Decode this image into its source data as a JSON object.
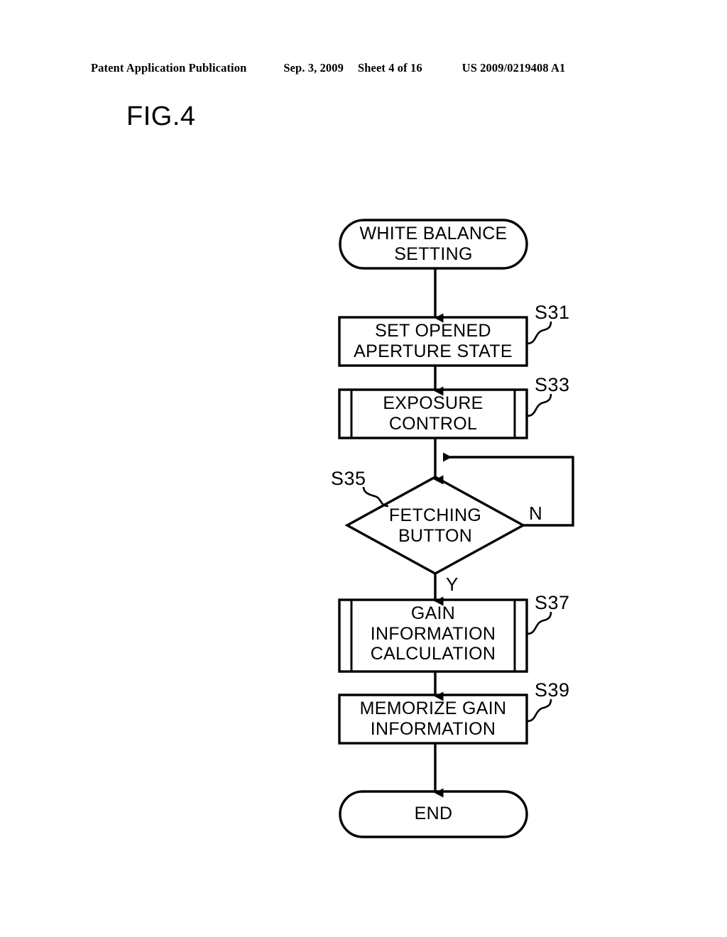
{
  "header": {
    "publication": "Patent Application Publication",
    "date": "Sep. 3, 2009",
    "sheet": "Sheet 4 of 16",
    "patent_number": "US 2009/0219408 A1"
  },
  "figure": {
    "label": "FIG.4"
  },
  "flowchart": {
    "nodes": [
      {
        "id": "start",
        "shape": "terminal",
        "text": "WHITE BALANCE\nSETTING"
      },
      {
        "id": "s31",
        "shape": "process",
        "text": "SET OPENED\nAPERTURE STATE",
        "step": "S31"
      },
      {
        "id": "s33",
        "shape": "predefined-process",
        "text": "EXPOSURE\nCONTROL",
        "step": "S33"
      },
      {
        "id": "s35",
        "shape": "decision",
        "text": "FETCHING\nBUTTON",
        "step": "S35"
      },
      {
        "id": "s37",
        "shape": "predefined-process",
        "text": "GAIN\nINFORMATION\nCALCULATION",
        "step": "S37"
      },
      {
        "id": "s39",
        "shape": "process",
        "text": "MEMORIZE GAIN\nINFORMATION",
        "step": "S39"
      },
      {
        "id": "end",
        "shape": "terminal",
        "text": "END"
      }
    ],
    "branches": {
      "no": "N",
      "yes": "Y"
    }
  },
  "colors": {
    "ink": "#000000",
    "paper": "#ffffff"
  }
}
